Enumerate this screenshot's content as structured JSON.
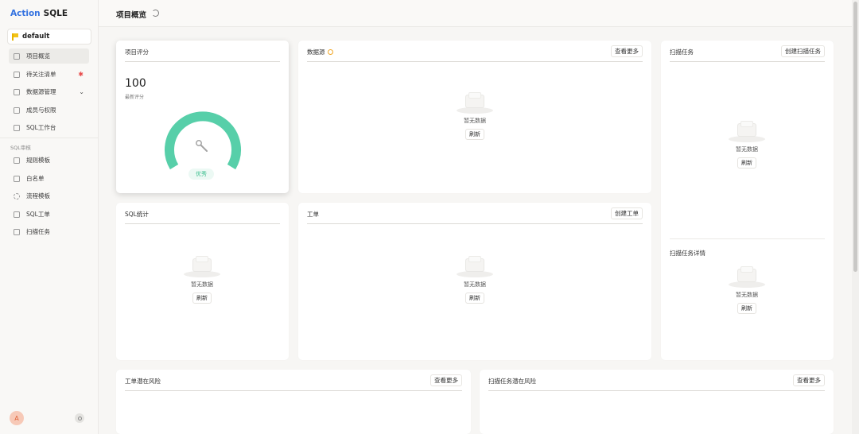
{
  "app": {
    "brand_part1": "Action",
    "brand_part2": "SQLE"
  },
  "sidebar": {
    "project": "default",
    "items": [
      {
        "label": "项目概览"
      },
      {
        "label": "待关注清单"
      },
      {
        "label": "数据源管理"
      },
      {
        "label": "成员与权限"
      },
      {
        "label": "SQL工作台"
      }
    ],
    "section_label": "SQL审核",
    "audit_items": [
      {
        "label": "规则模板"
      },
      {
        "label": "白名单"
      },
      {
        "label": "流程模板"
      },
      {
        "label": "SQL工单"
      },
      {
        "label": "扫描任务"
      }
    ],
    "avatar_letter": "A"
  },
  "header": {
    "title": "项目概览"
  },
  "cards": {
    "score": {
      "title": "项目评分",
      "value": "100",
      "subtitle": "最新评分",
      "grade": "优秀",
      "gauge_color": "#57cfa9"
    },
    "datasource": {
      "title": "数据源",
      "button": "查看更多",
      "empty_text": "暂无数据",
      "refresh": "刷新"
    },
    "scan": {
      "title": "扫描任务",
      "button": "创建扫描任务",
      "empty_text": "暂无数据",
      "refresh": "刷新"
    },
    "scan_detail": {
      "title": "扫描任务详情",
      "empty_text": "暂无数据",
      "refresh": "刷新"
    },
    "sql_stats": {
      "title": "SQL统计",
      "empty_text": "暂无数据",
      "refresh": "刷新"
    },
    "orders": {
      "title": "工单",
      "button": "创建工单",
      "empty_text": "暂无数据",
      "refresh": "刷新"
    },
    "order_risk": {
      "title": "工单潜在风险",
      "button": "查看更多"
    },
    "scan_risk": {
      "title": "扫描任务潜在风险",
      "button": "查看更多"
    }
  }
}
